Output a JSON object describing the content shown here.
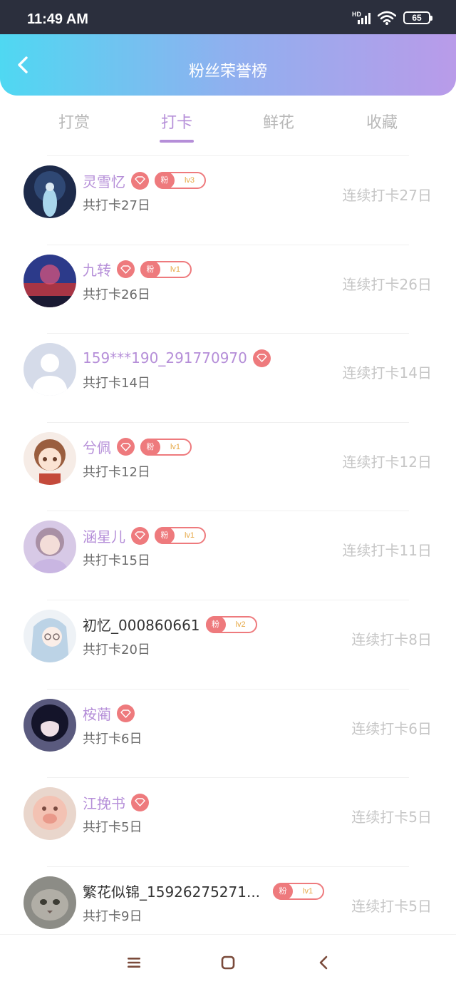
{
  "status_bar": {
    "time": "11:49 AM",
    "network": "HD",
    "battery": "65"
  },
  "header": {
    "title": "粉丝荣誉榜"
  },
  "tabs": [
    {
      "label": "打赏",
      "active": false
    },
    {
      "label": "打卡",
      "active": true
    },
    {
      "label": "鲜花",
      "active": false
    },
    {
      "label": "收藏",
      "active": false
    }
  ],
  "rows": [
    {
      "name": "灵雪忆",
      "vip": true,
      "fan_badge": {
        "label": "粉",
        "level": "lv3"
      },
      "total": "共打卡27日",
      "streak": "连续打卡27日"
    },
    {
      "name": "九转",
      "vip": true,
      "fan_badge": {
        "label": "粉",
        "level": "lv1"
      },
      "total": "共打卡26日",
      "streak": "连续打卡26日"
    },
    {
      "name": "159***190_291770970",
      "vip": true,
      "fan_badge": null,
      "total": "共打卡14日",
      "streak": "连续打卡14日"
    },
    {
      "name": "兮佩",
      "vip": true,
      "fan_badge": {
        "label": "粉",
        "level": "lv1"
      },
      "total": "共打卡12日",
      "streak": "连续打卡12日"
    },
    {
      "name": "涵星儿",
      "vip": true,
      "fan_badge": {
        "label": "粉",
        "level": "lv1"
      },
      "total": "共打卡15日",
      "streak": "连续打卡11日"
    },
    {
      "name": "初忆_000860661",
      "vip": false,
      "fan_badge": {
        "label": "粉",
        "level": "lv2"
      },
      "total": "共打卡20日",
      "streak": "连续打卡8日"
    },
    {
      "name": "桉蔺",
      "vip": true,
      "fan_badge": null,
      "total": "共打卡6日",
      "streak": "连续打卡6日"
    },
    {
      "name": "江挽书",
      "vip": true,
      "fan_badge": null,
      "total": "共打卡5日",
      "streak": "连续打卡5日"
    },
    {
      "name": "繁花似锦_15926275271...",
      "vip": false,
      "fan_badge": {
        "label": "粉",
        "level": "lv1"
      },
      "total": "共打卡9日",
      "streak": "连续打卡5日"
    }
  ],
  "colors": {
    "accent": "#b58ed8",
    "badge": "#ee7a7d",
    "header_start": "#4fd8f2",
    "header_end": "#b99be9"
  }
}
